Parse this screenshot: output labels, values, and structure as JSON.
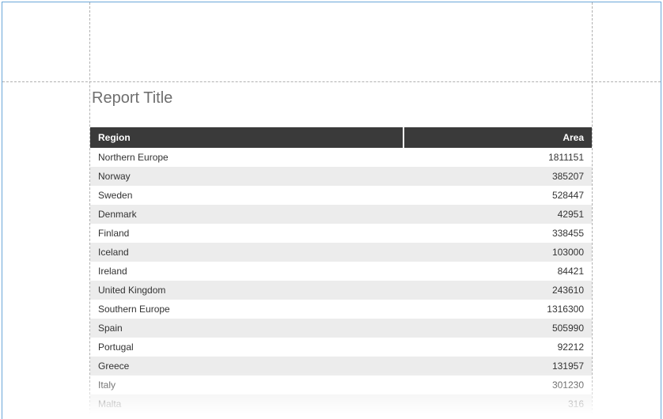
{
  "report": {
    "title": "Report Title"
  },
  "table": {
    "columns": {
      "region": "Region",
      "area": "Area"
    },
    "rows": [
      {
        "region": "Northern Europe",
        "area": "1811151"
      },
      {
        "region": "Norway",
        "area": "385207"
      },
      {
        "region": "Sweden",
        "area": "528447"
      },
      {
        "region": "Denmark",
        "area": "42951"
      },
      {
        "region": "Finland",
        "area": "338455"
      },
      {
        "region": "Iceland",
        "area": "103000"
      },
      {
        "region": "Ireland",
        "area": "84421"
      },
      {
        "region": "United Kingdom",
        "area": "243610"
      },
      {
        "region": "Southern Europe",
        "area": "1316300"
      },
      {
        "region": "Spain",
        "area": "505990"
      },
      {
        "region": "Portugal",
        "area": "92212"
      },
      {
        "region": "Greece",
        "area": "131957"
      },
      {
        "region": "Italy",
        "area": "301230"
      },
      {
        "region": "Malta",
        "area": "316"
      }
    ]
  }
}
